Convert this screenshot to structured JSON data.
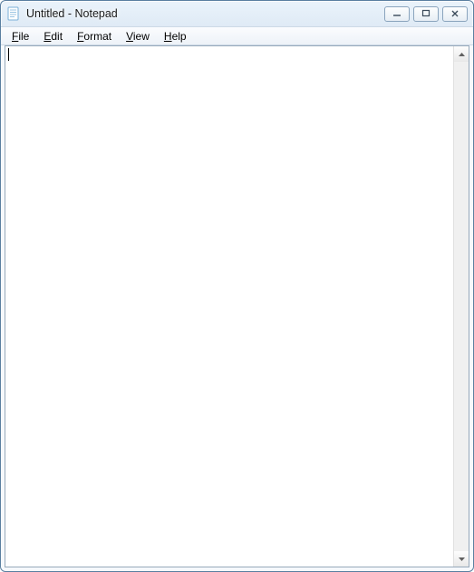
{
  "window": {
    "title": "Untitled - Notepad"
  },
  "menu": {
    "file": "File",
    "edit": "Edit",
    "format": "Format",
    "view": "View",
    "help": "Help"
  },
  "editor": {
    "content": "",
    "placeholder": ""
  },
  "icons": {
    "app": "notepad-icon",
    "minimize": "minimize-icon",
    "maximize": "maximize-icon",
    "close": "close-icon",
    "scroll_up": "scroll-up-icon",
    "scroll_down": "scroll-down-icon"
  }
}
